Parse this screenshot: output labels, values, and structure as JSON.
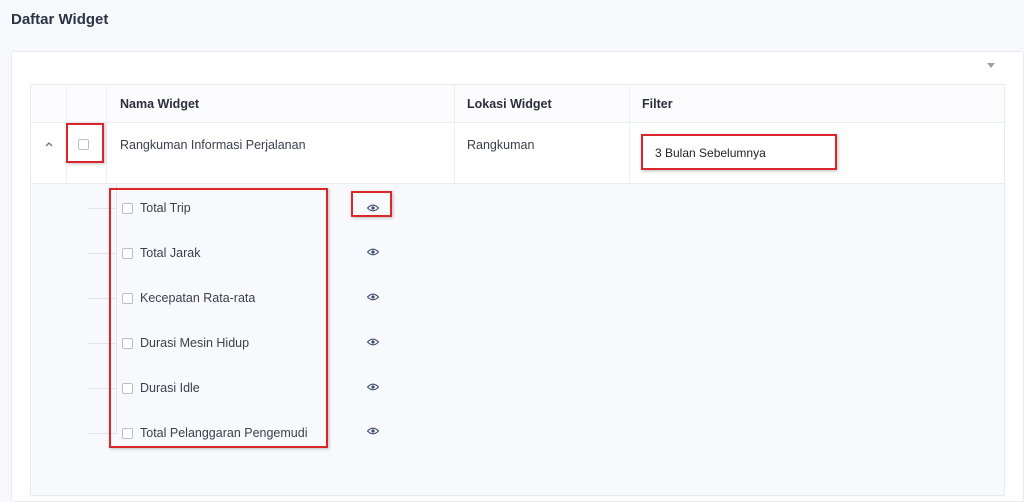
{
  "page": {
    "title": "Daftar Widget"
  },
  "table": {
    "headers": {
      "name": "Nama Widget",
      "location": "Lokasi Widget",
      "filter": "Filter"
    },
    "row": {
      "name": "Rangkuman Informasi Perjalanan",
      "location": "Rangkuman",
      "filter_value": "3 Bulan Sebelumnya",
      "expanded": true
    },
    "sub_items": [
      {
        "label": "Total Trip",
        "icon": "eye-icon"
      },
      {
        "label": "Total Jarak",
        "icon": "eye-icon"
      },
      {
        "label": "Kecepatan Rata-rata",
        "icon": "eye-icon"
      },
      {
        "label": "Durasi Mesin Hidup",
        "icon": "eye-icon"
      },
      {
        "label": "Durasi Idle",
        "icon": "eye-icon"
      },
      {
        "label": "Total Pelanggaran Pengemudi",
        "icon": "eye-icon"
      }
    ]
  },
  "colors": {
    "highlight": "#d9262b",
    "icon": "#3f4d6b"
  }
}
